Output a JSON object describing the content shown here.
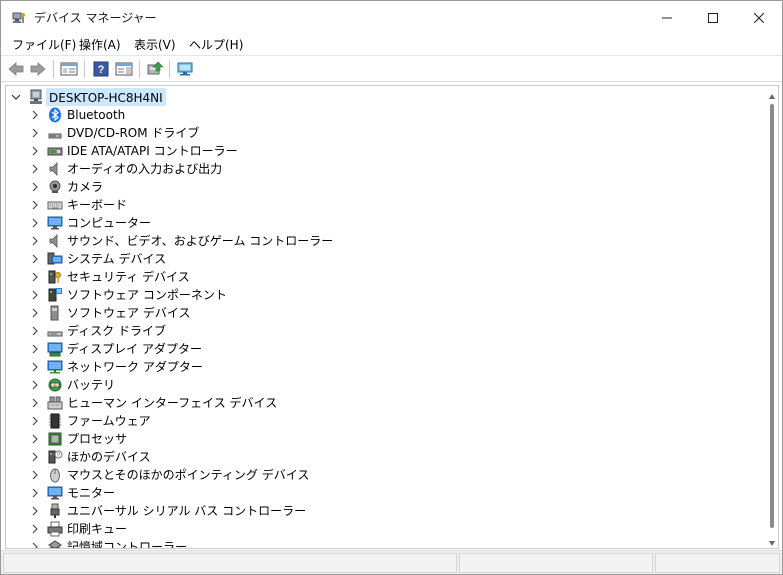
{
  "window": {
    "title": "デバイス マネージャー",
    "title_icon": "device-manager-icon"
  },
  "menu": [
    {
      "label": "ファイル(F)"
    },
    {
      "label": "操作(A)"
    },
    {
      "label": "表示(V)"
    },
    {
      "label": "ヘルプ(H)"
    }
  ],
  "toolbar": {
    "buttons": [
      "back-icon",
      "forward-icon",
      "show-hide-console-tree-icon",
      "help-icon",
      "properties-panel-icon",
      "update-driver-icon",
      "scan-hardware-icon"
    ]
  },
  "tree": {
    "root": {
      "label": "DESKTOP-HC8H4NI",
      "icon": "computer-root-icon",
      "expanded": true,
      "selected": true
    },
    "items": [
      {
        "label": "Bluetooth",
        "icon": "bluetooth-icon"
      },
      {
        "label": "DVD/CD-ROM ドライブ",
        "icon": "dvd-drive-icon"
      },
      {
        "label": "IDE ATA/ATAPI コントローラー",
        "icon": "ide-controller-icon"
      },
      {
        "label": "オーディオの入力および出力",
        "icon": "audio-icon"
      },
      {
        "label": "カメラ",
        "icon": "camera-icon"
      },
      {
        "label": "キーボード",
        "icon": "keyboard-icon"
      },
      {
        "label": "コンピューター",
        "icon": "computer-icon"
      },
      {
        "label": "サウンド、ビデオ、およびゲーム コントローラー",
        "icon": "sound-icon"
      },
      {
        "label": "システム デバイス",
        "icon": "system-devices-icon"
      },
      {
        "label": "セキュリティ デバイス",
        "icon": "security-devices-icon"
      },
      {
        "label": "ソフトウェア コンポーネント",
        "icon": "software-components-icon"
      },
      {
        "label": "ソフトウェア デバイス",
        "icon": "software-devices-icon"
      },
      {
        "label": "ディスク ドライブ",
        "icon": "disk-drive-icon"
      },
      {
        "label": "ディスプレイ アダプター",
        "icon": "display-adapter-icon"
      },
      {
        "label": "ネットワーク アダプター",
        "icon": "network-adapter-icon"
      },
      {
        "label": "バッテリ",
        "icon": "battery-icon"
      },
      {
        "label": "ヒューマン インターフェイス デバイス",
        "icon": "hid-icon"
      },
      {
        "label": "ファームウェア",
        "icon": "firmware-icon"
      },
      {
        "label": "プロセッサ",
        "icon": "processor-icon"
      },
      {
        "label": "ほかのデバイス",
        "icon": "other-devices-icon"
      },
      {
        "label": "マウスとそのほかのポインティング デバイス",
        "icon": "mouse-icon"
      },
      {
        "label": "モニター",
        "icon": "monitor-icon"
      },
      {
        "label": "ユニバーサル シリアル バス コントローラー",
        "icon": "usb-icon"
      },
      {
        "label": "印刷キュー",
        "icon": "print-queue-icon"
      },
      {
        "label": "記憶域コントローラー",
        "icon": "storage-controller-icon"
      }
    ]
  },
  "colors": {
    "selection": "#cce8ff",
    "monitor_blue": "#2f7fd0",
    "bluetooth_blue": "#1a73e8",
    "scroll_thumb": "#8a8a8a"
  }
}
